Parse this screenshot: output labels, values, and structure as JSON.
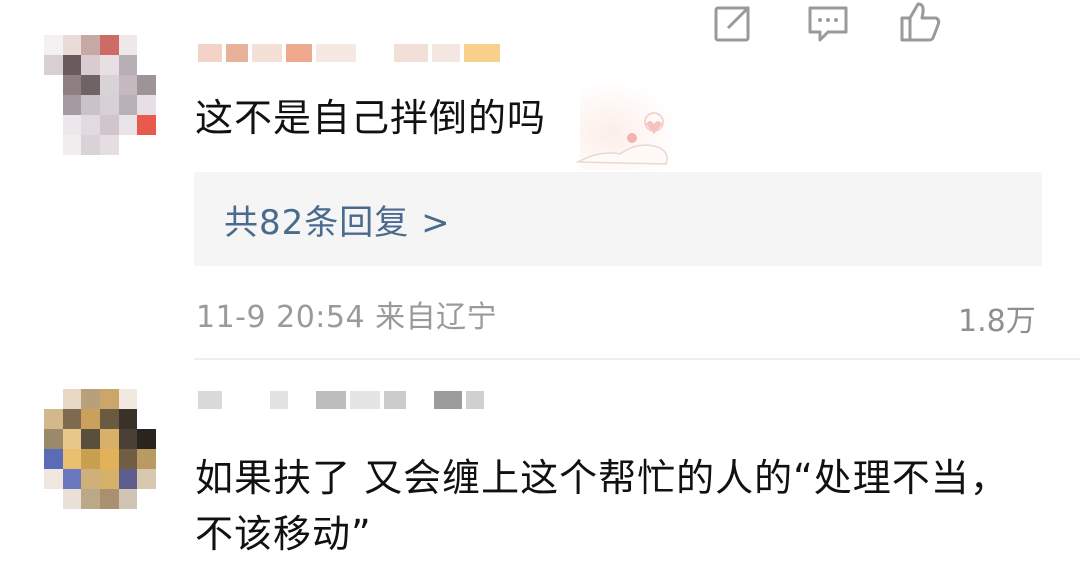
{
  "comments": [
    {
      "text": "这不是自己拌倒的吗",
      "replies_label": "共82条回复 >",
      "meta": "11-9 20:54 来自辽宁",
      "like_count": "1.8万",
      "icons": [
        "share-icon",
        "comment-icon",
        "like-icon"
      ]
    },
    {
      "text": "如果扶了 又会缠上这个帮忙的人的“处理不当，不该移动”"
    }
  ],
  "colors": {
    "reply_link": "#4a6b8e",
    "meta_text": "#9a9a9a",
    "reply_box": "#f5f5f5"
  }
}
